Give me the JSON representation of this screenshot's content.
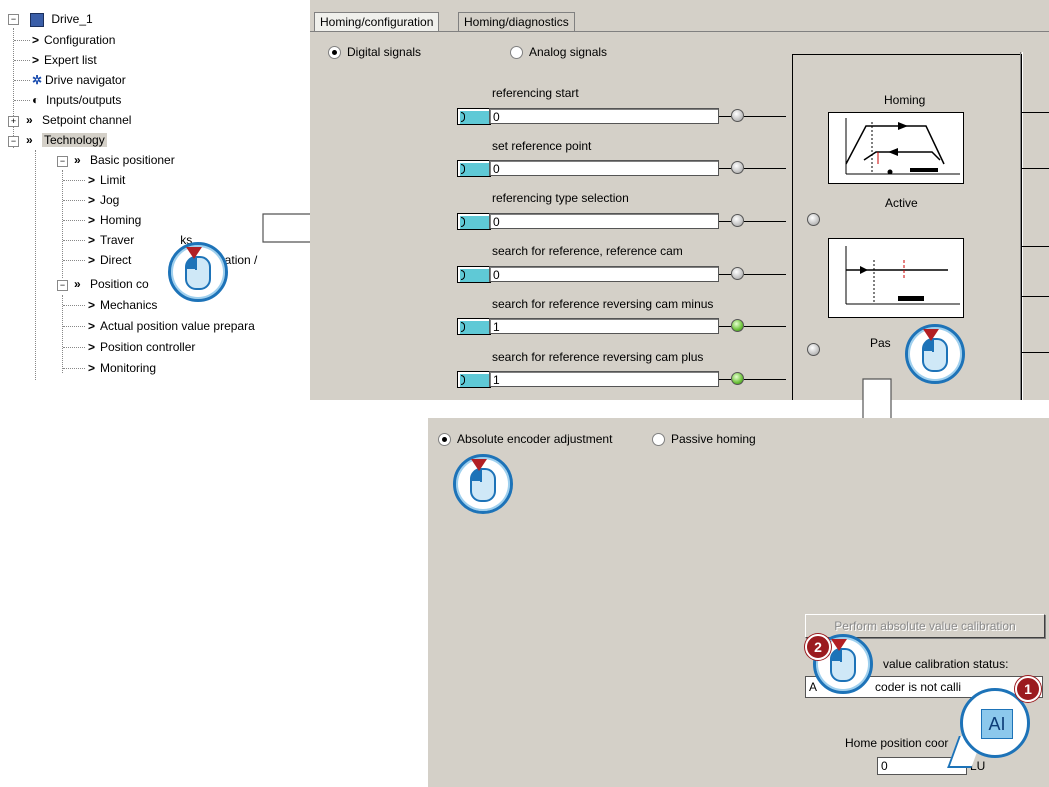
{
  "tree": {
    "root": "Drive_1",
    "items": [
      {
        "label": "Configuration"
      },
      {
        "label": "Expert list"
      },
      {
        "label": "Drive navigator"
      },
      {
        "label": "Inputs/outputs"
      },
      {
        "label": "Setpoint channel"
      },
      {
        "label": "Technology"
      },
      {
        "label": "Basic positioner"
      },
      {
        "label": "Limit"
      },
      {
        "label": "Jog"
      },
      {
        "label": "Homing"
      },
      {
        "label": "Traver"
      },
      {
        "label": "ks"
      },
      {
        "label": "Direct"
      },
      {
        "label": "ecification /"
      },
      {
        "label": "Position co"
      },
      {
        "label": "Mechanics"
      },
      {
        "label": "Actual position value prepara"
      },
      {
        "label": "Position controller"
      },
      {
        "label": "Monitoring"
      }
    ],
    "expander_plus": "+",
    "expander_minus": "−"
  },
  "homing_panel": {
    "tabs": [
      "Homing/configuration",
      "Homing/diagnostics"
    ],
    "radio_digital": "Digital signals",
    "radio_analog": "Analog signals",
    "signals": [
      {
        "label": "referencing start",
        "value": "0",
        "led": "grey"
      },
      {
        "label": "set reference point",
        "value": "0",
        "led": "grey"
      },
      {
        "label": "referencing type selection",
        "value": "0",
        "led": "grey"
      },
      {
        "label": "search for reference, reference cam",
        "value": "0",
        "led": "grey"
      },
      {
        "label": "search for reference reversing cam minus",
        "value": "1",
        "led": "green"
      },
      {
        "label": "search for reference reversing cam plus",
        "value": "1",
        "led": "green"
      }
    ],
    "diagram_title": "Homing",
    "active_label": "Active",
    "passive_label": "Pas"
  },
  "calibration_panel": {
    "radio_absolute": "Absolute encoder adjustment",
    "radio_passive": "Passive homing",
    "perform_button": "Perform absolute value calibration",
    "status_label": "value calibration status:",
    "status_prefix": "A",
    "status_value": "coder is not calli",
    "home_position_label": "Home position coor",
    "home_position_value": "0",
    "unit": "LU"
  },
  "badges": {
    "step1": "1",
    "step2": "2",
    "ai_glyph": "AI"
  },
  "colors": {
    "panel_bg": "#d4d0c8",
    "badge_blue": "#1d73b8",
    "badge_red": "#9b1b1f",
    "bico_cyan": "#5fc9d6",
    "led_green": "#6cc23a"
  }
}
